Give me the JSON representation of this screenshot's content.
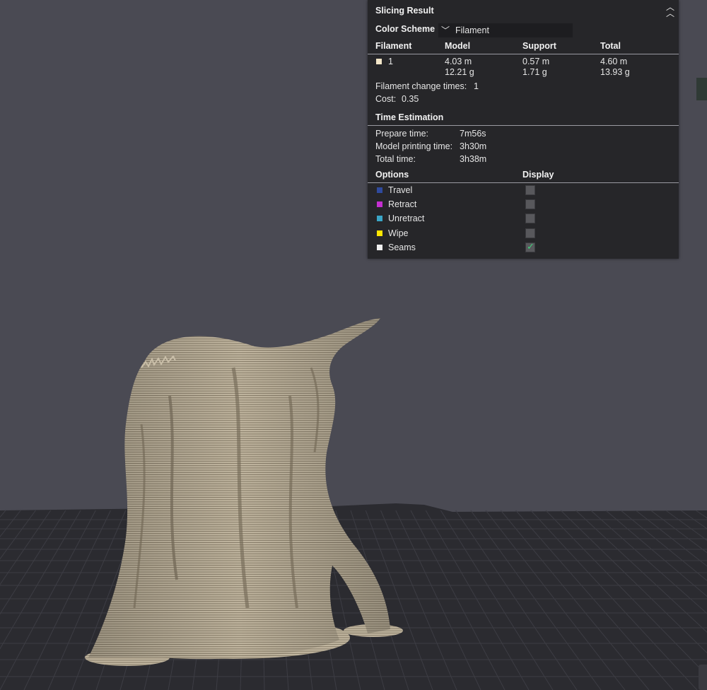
{
  "panel": {
    "title": "Slicing Result",
    "color_scheme_label": "Color Scheme",
    "color_scheme_value": "Filament",
    "columns": {
      "filament": "Filament",
      "model": "Model",
      "support": "Support",
      "total": "Total"
    },
    "filament_row": {
      "id": "1",
      "swatch_color": "#f3e6c8",
      "model_length": "4.03 m",
      "model_weight": "12.21 g",
      "support_length": "0.57 m",
      "support_weight": "1.71 g",
      "total_length": "4.60 m",
      "total_weight": "13.93 g"
    },
    "filament_change_label": "Filament change times:",
    "filament_change_value": "1",
    "cost_label": "Cost:",
    "cost_value": "0.35",
    "time_section_title": "Time Estimation",
    "prepare_label": "Prepare time:",
    "prepare_value": "7m56s",
    "model_time_label": "Model printing time:",
    "model_time_value": "3h30m",
    "total_time_label": "Total time:",
    "total_time_value": "3h38m",
    "options_header": "Options",
    "display_header": "Display",
    "options": [
      {
        "label": "Travel",
        "color": "#2f4a9e",
        "display": false
      },
      {
        "label": "Retract",
        "color": "#c42fd0",
        "display": false
      },
      {
        "label": "Unretract",
        "color": "#3aa6c7",
        "display": false
      },
      {
        "label": "Wipe",
        "color": "#ffe600",
        "display": false
      },
      {
        "label": "Seams",
        "color": "#f0f0f0",
        "display": true
      }
    ],
    "collapse_icon": "double-chevron-up-icon",
    "dropdown_icon": "chevron-down-icon",
    "checkmark_icon": "checkmark-icon"
  },
  "viewport": {
    "background_color": "#4a4a53",
    "bed_color": "#2b2b30",
    "grid_color": "#3c3c42",
    "model_color": "#bdb29b"
  }
}
